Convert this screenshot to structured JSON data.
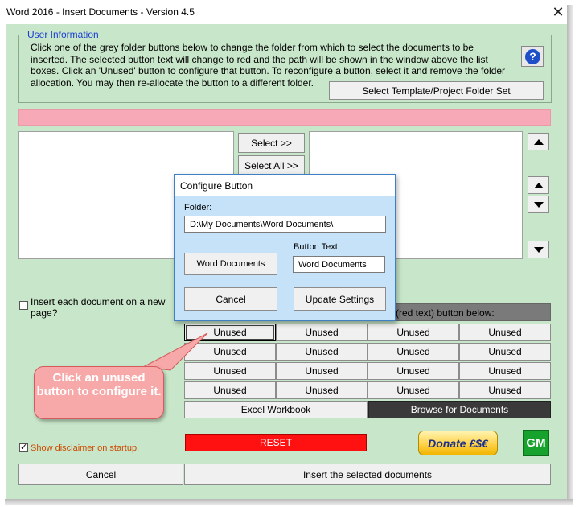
{
  "window": {
    "title": "Word 2016 - Insert Documents - Version 4.5",
    "close_glyph": "✕"
  },
  "user_info": {
    "legend": "User Information",
    "text": "Click one of the grey folder buttons below to change the folder from which to select the documents to be inserted. The selected button text will change to red and the path will be shown in the window above the list boxes. Click an 'Unused' button to configure that button. To reconfigure a button, select it and remove the folder allocation. You may then re-allocate the button to a different folder.",
    "help_glyph": "?",
    "select_set_label": "Select Template/Project Folder Set"
  },
  "path_display": "",
  "transfer": {
    "select_label": "Select >>",
    "select_all_label": "Select All >>"
  },
  "insert_each": {
    "label": "Insert each document on a new page?",
    "checked": false
  },
  "grid": {
    "header_partial": "(red text) button below:",
    "rows": [
      [
        "Unused",
        "Unused",
        "Unused",
        "Unused"
      ],
      [
        "Unused",
        "Unused",
        "Unused",
        "Unused"
      ],
      [
        "Unused",
        "Unused",
        "Unused",
        "Unused"
      ],
      [
        "Unused",
        "Unused",
        "Unused",
        "Unused"
      ]
    ],
    "excel_label": "Excel Workbook",
    "browse_label": "Browse for Documents"
  },
  "disclaimer": {
    "label": "Show disclaimer on startup.",
    "checked": true
  },
  "reset_label": "RESET",
  "donate_label": "Donate £$€",
  "gm_label": "GM",
  "footer": {
    "cancel_label": "Cancel",
    "insert_label": "Insert the selected documents"
  },
  "dialog": {
    "title": "Configure Button",
    "folder_label": "Folder:",
    "folder_value": "D:\\My Documents\\Word Documents\\",
    "button_text_label": "Button Text:",
    "button_text_value": "Word Documents",
    "preview_label": "Word Documents",
    "cancel_label": "Cancel",
    "update_label": "Update Settings"
  },
  "callout": {
    "text": "Click an unused button to configure it."
  },
  "colors": {
    "client_bg": "#c8e6c9",
    "legend_text": "#1a3fd4",
    "path_bar": "#f7a9b8",
    "reset_bg": "#ff1111",
    "browse_bg": "#3a3a3a",
    "disclaimer_text": "#cc4a00",
    "callout_bg": "#f7a9a9"
  }
}
